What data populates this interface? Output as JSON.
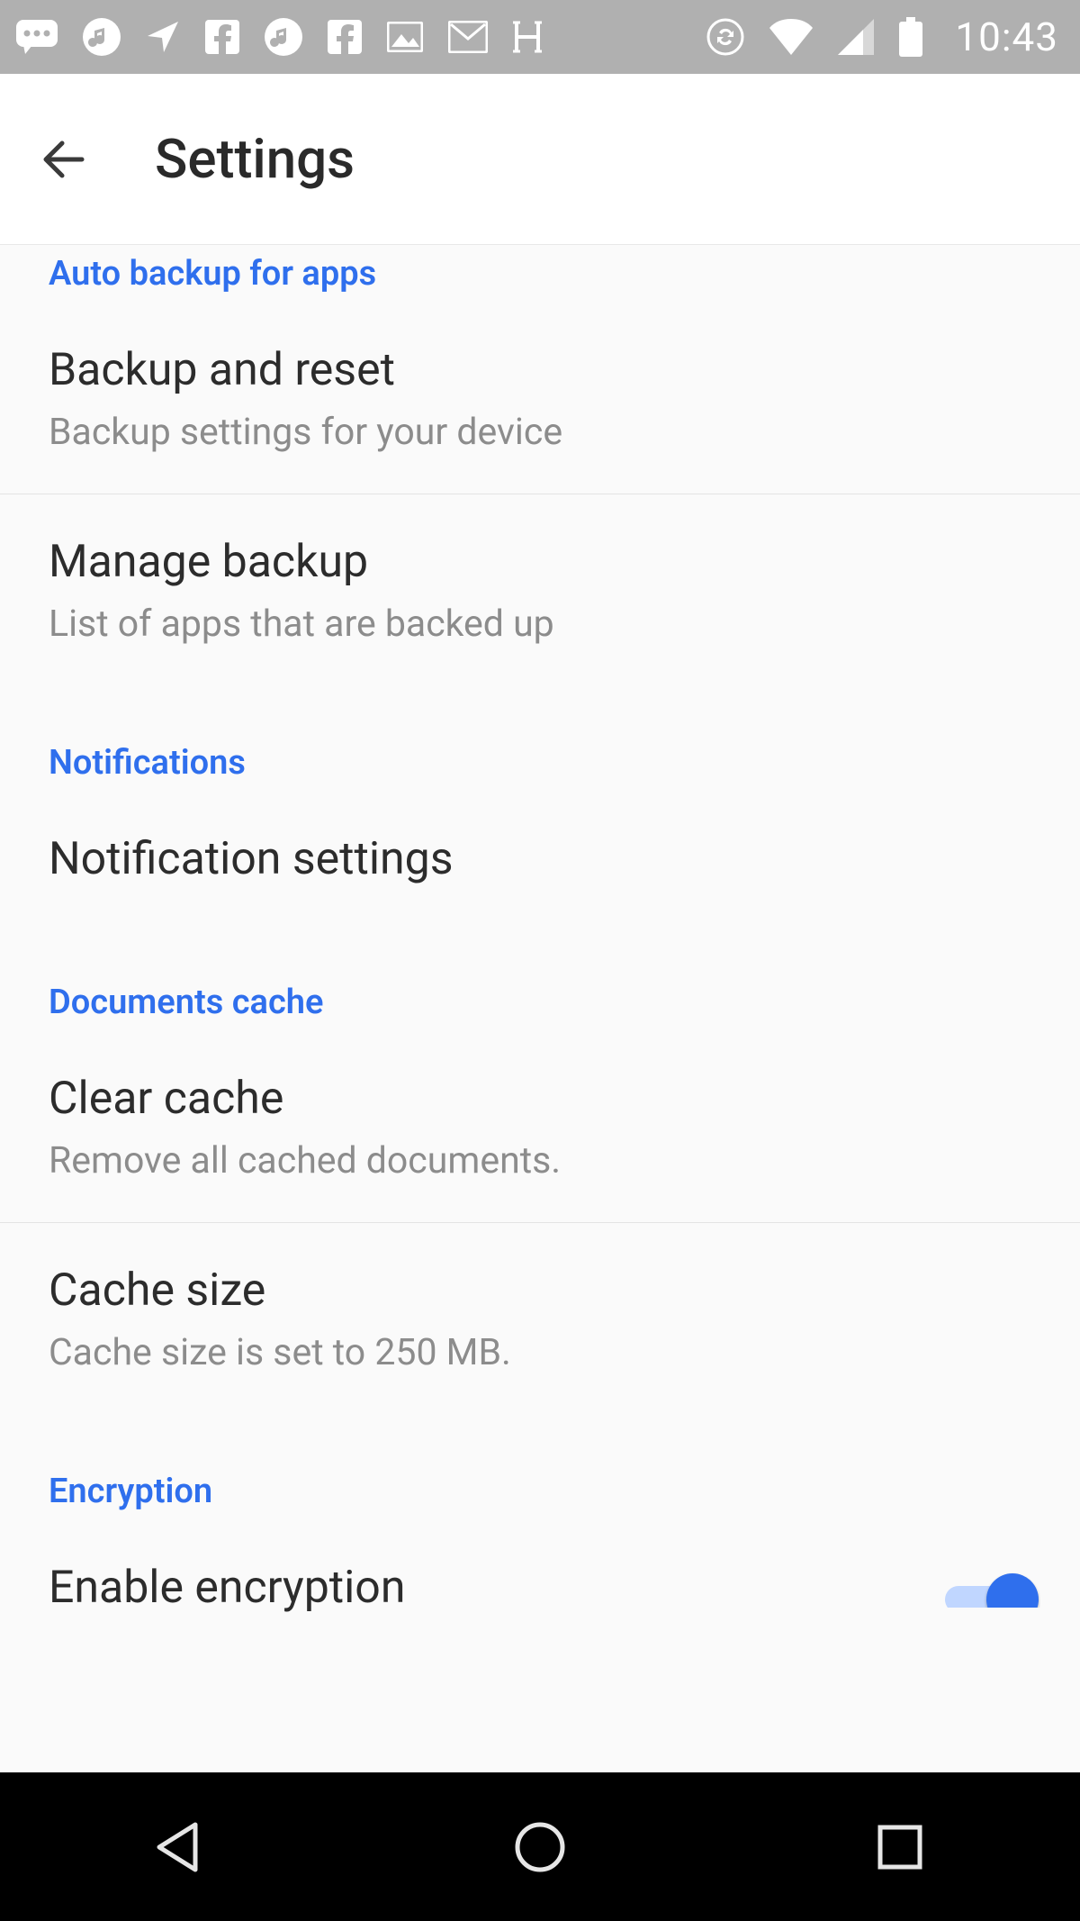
{
  "statusbar": {
    "time": "10:43"
  },
  "header": {
    "title": "Settings"
  },
  "sections": {
    "autoBackup": {
      "label": "Auto backup for apps",
      "backupReset": {
        "title": "Backup and reset",
        "subtitle": "Backup settings for your device"
      },
      "manageBackup": {
        "title": "Manage backup",
        "subtitle": "List of apps that are backed up"
      }
    },
    "notifications": {
      "label": "Notifications",
      "notificationSettings": {
        "title": "Notification settings"
      }
    },
    "documentsCache": {
      "label": "Documents cache",
      "clearCache": {
        "title": "Clear cache",
        "subtitle": "Remove all cached documents."
      },
      "cacheSize": {
        "title": "Cache size",
        "subtitle": "Cache size is set to 250 MB."
      }
    },
    "encryption": {
      "label": "Encryption",
      "enableEncryption": {
        "title": "Enable encryption",
        "toggled": true
      }
    }
  }
}
